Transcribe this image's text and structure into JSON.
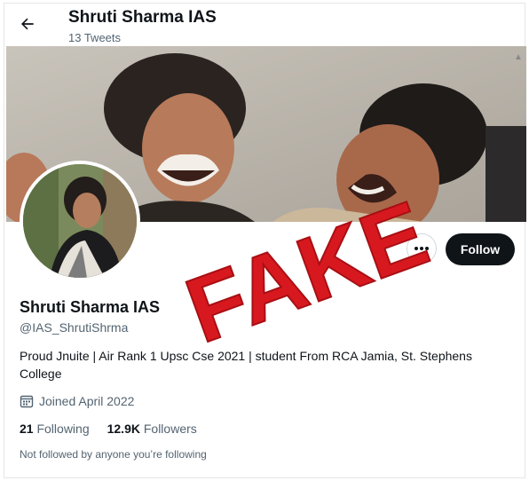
{
  "header": {
    "name": "Shruti Sharma IAS",
    "tweets_count": "13 Tweets"
  },
  "profile": {
    "name": "Shruti Sharma IAS",
    "handle": "@IAS_ShrutiShrma",
    "bio": "Proud Jnuite | Air Rank 1 Upsc Cse 2021 | student From RCA Jamia, St. Stephens College",
    "joined": "Joined April 2022",
    "following_count": "21",
    "following_label": "Following",
    "followers_count": "12.9K",
    "followers_label": "Followers",
    "not_followed_text": "Not followed by anyone you’re following"
  },
  "actions": {
    "follow_label": "Follow",
    "more_label": "•••"
  },
  "overlay": {
    "stamp_text": "FAKE",
    "stamp_color": "#d7191f"
  },
  "icons": {
    "back": "arrow-left-icon",
    "more": "more-horizontal-icon",
    "calendar": "calendar-icon"
  }
}
